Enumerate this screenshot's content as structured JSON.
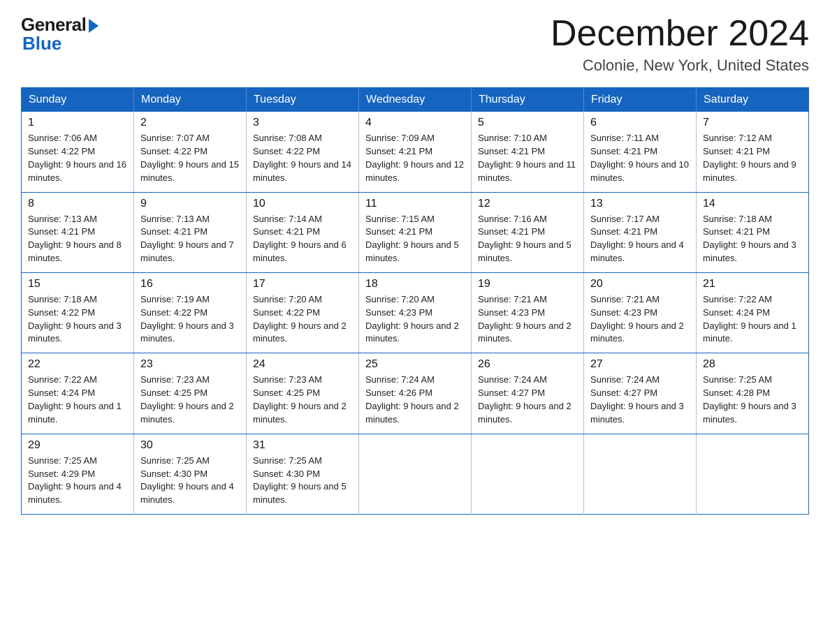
{
  "header": {
    "logo_general": "General",
    "logo_blue": "Blue",
    "month_title": "December 2024",
    "subtitle": "Colonie, New York, United States"
  },
  "days_of_week": [
    "Sunday",
    "Monday",
    "Tuesday",
    "Wednesday",
    "Thursday",
    "Friday",
    "Saturday"
  ],
  "weeks": [
    [
      {
        "day": "1",
        "sunrise": "7:06 AM",
        "sunset": "4:22 PM",
        "daylight": "9 hours and 16 minutes."
      },
      {
        "day": "2",
        "sunrise": "7:07 AM",
        "sunset": "4:22 PM",
        "daylight": "9 hours and 15 minutes."
      },
      {
        "day": "3",
        "sunrise": "7:08 AM",
        "sunset": "4:22 PM",
        "daylight": "9 hours and 14 minutes."
      },
      {
        "day": "4",
        "sunrise": "7:09 AM",
        "sunset": "4:21 PM",
        "daylight": "9 hours and 12 minutes."
      },
      {
        "day": "5",
        "sunrise": "7:10 AM",
        "sunset": "4:21 PM",
        "daylight": "9 hours and 11 minutes."
      },
      {
        "day": "6",
        "sunrise": "7:11 AM",
        "sunset": "4:21 PM",
        "daylight": "9 hours and 10 minutes."
      },
      {
        "day": "7",
        "sunrise": "7:12 AM",
        "sunset": "4:21 PM",
        "daylight": "9 hours and 9 minutes."
      }
    ],
    [
      {
        "day": "8",
        "sunrise": "7:13 AM",
        "sunset": "4:21 PM",
        "daylight": "9 hours and 8 minutes."
      },
      {
        "day": "9",
        "sunrise": "7:13 AM",
        "sunset": "4:21 PM",
        "daylight": "9 hours and 7 minutes."
      },
      {
        "day": "10",
        "sunrise": "7:14 AM",
        "sunset": "4:21 PM",
        "daylight": "9 hours and 6 minutes."
      },
      {
        "day": "11",
        "sunrise": "7:15 AM",
        "sunset": "4:21 PM",
        "daylight": "9 hours and 5 minutes."
      },
      {
        "day": "12",
        "sunrise": "7:16 AM",
        "sunset": "4:21 PM",
        "daylight": "9 hours and 5 minutes."
      },
      {
        "day": "13",
        "sunrise": "7:17 AM",
        "sunset": "4:21 PM",
        "daylight": "9 hours and 4 minutes."
      },
      {
        "day": "14",
        "sunrise": "7:18 AM",
        "sunset": "4:21 PM",
        "daylight": "9 hours and 3 minutes."
      }
    ],
    [
      {
        "day": "15",
        "sunrise": "7:18 AM",
        "sunset": "4:22 PM",
        "daylight": "9 hours and 3 minutes."
      },
      {
        "day": "16",
        "sunrise": "7:19 AM",
        "sunset": "4:22 PM",
        "daylight": "9 hours and 3 minutes."
      },
      {
        "day": "17",
        "sunrise": "7:20 AM",
        "sunset": "4:22 PM",
        "daylight": "9 hours and 2 minutes."
      },
      {
        "day": "18",
        "sunrise": "7:20 AM",
        "sunset": "4:23 PM",
        "daylight": "9 hours and 2 minutes."
      },
      {
        "day": "19",
        "sunrise": "7:21 AM",
        "sunset": "4:23 PM",
        "daylight": "9 hours and 2 minutes."
      },
      {
        "day": "20",
        "sunrise": "7:21 AM",
        "sunset": "4:23 PM",
        "daylight": "9 hours and 2 minutes."
      },
      {
        "day": "21",
        "sunrise": "7:22 AM",
        "sunset": "4:24 PM",
        "daylight": "9 hours and 1 minute."
      }
    ],
    [
      {
        "day": "22",
        "sunrise": "7:22 AM",
        "sunset": "4:24 PM",
        "daylight": "9 hours and 1 minute."
      },
      {
        "day": "23",
        "sunrise": "7:23 AM",
        "sunset": "4:25 PM",
        "daylight": "9 hours and 2 minutes."
      },
      {
        "day": "24",
        "sunrise": "7:23 AM",
        "sunset": "4:25 PM",
        "daylight": "9 hours and 2 minutes."
      },
      {
        "day": "25",
        "sunrise": "7:24 AM",
        "sunset": "4:26 PM",
        "daylight": "9 hours and 2 minutes."
      },
      {
        "day": "26",
        "sunrise": "7:24 AM",
        "sunset": "4:27 PM",
        "daylight": "9 hours and 2 minutes."
      },
      {
        "day": "27",
        "sunrise": "7:24 AM",
        "sunset": "4:27 PM",
        "daylight": "9 hours and 3 minutes."
      },
      {
        "day": "28",
        "sunrise": "7:25 AM",
        "sunset": "4:28 PM",
        "daylight": "9 hours and 3 minutes."
      }
    ],
    [
      {
        "day": "29",
        "sunrise": "7:25 AM",
        "sunset": "4:29 PM",
        "daylight": "9 hours and 4 minutes."
      },
      {
        "day": "30",
        "sunrise": "7:25 AM",
        "sunset": "4:30 PM",
        "daylight": "9 hours and 4 minutes."
      },
      {
        "day": "31",
        "sunrise": "7:25 AM",
        "sunset": "4:30 PM",
        "daylight": "9 hours and 5 minutes."
      },
      null,
      null,
      null,
      null
    ]
  ]
}
